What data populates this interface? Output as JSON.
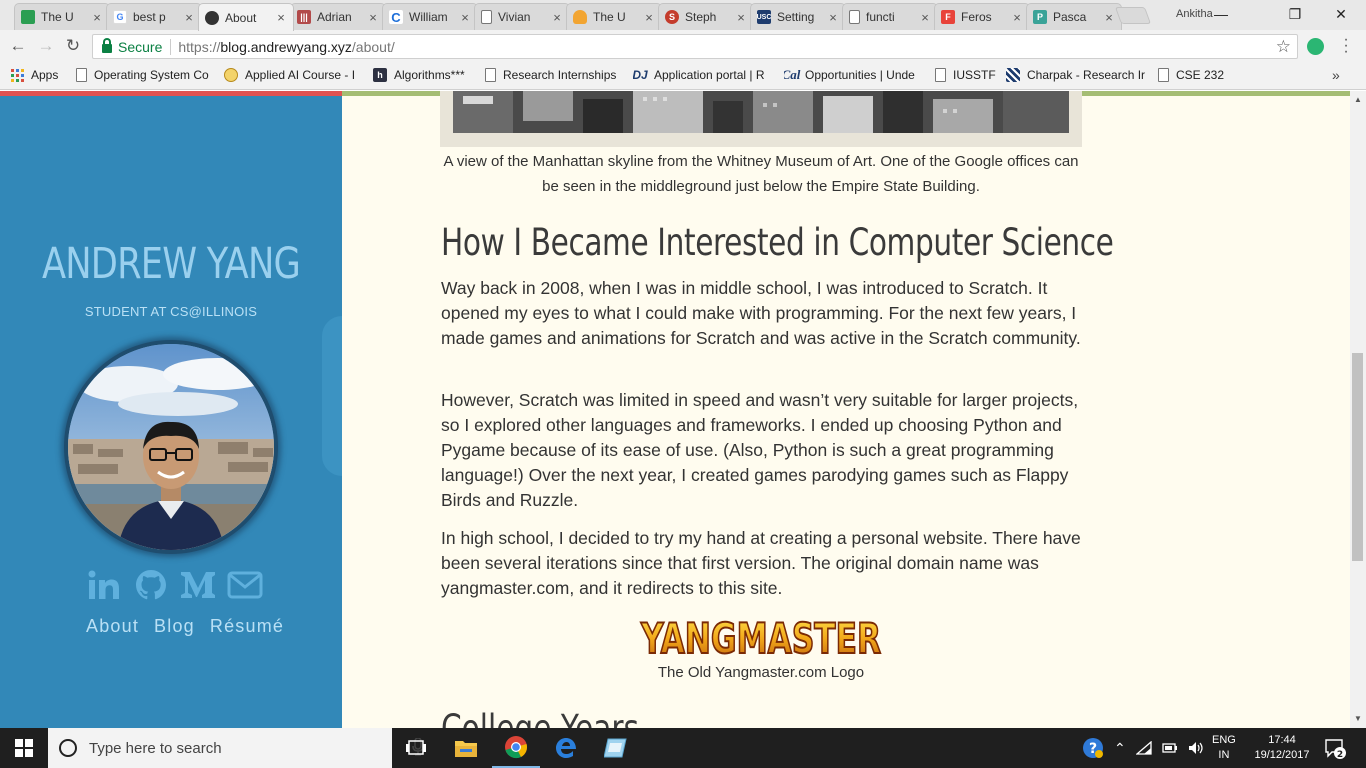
{
  "browser": {
    "tabs": [
      {
        "title": "The U",
        "icon": "classroom-icon",
        "color": "#2b9e52"
      },
      {
        "title": "best p",
        "icon": "google-icon",
        "color": "#4285f4"
      },
      {
        "title": "About",
        "icon": "site-icon",
        "color": "#333333",
        "active": true
      },
      {
        "title": "Adrian",
        "icon": "bars-icon",
        "color": "#b24a4a"
      },
      {
        "title": "William",
        "icon": "c-icon",
        "color": "#1e6fd9"
      },
      {
        "title": "Vivian",
        "icon": "page-icon",
        "color": "#777777"
      },
      {
        "title": "The U",
        "icon": "cloud-icon",
        "color": "#f2a532"
      },
      {
        "title": "Steph",
        "icon": "s-icon",
        "color": "#c43c2c"
      },
      {
        "title": "Setting",
        "icon": "usc-icon",
        "color": "#1e3c6e"
      },
      {
        "title": "functi",
        "icon": "page-icon",
        "color": "#777777"
      },
      {
        "title": "Feros",
        "icon": "f-icon",
        "color": "#e8433a"
      },
      {
        "title": "Pasca",
        "icon": "p-icon",
        "color": "#3aa398"
      }
    ],
    "profile_name": "Ankitha",
    "window_controls": {
      "minimize": "—",
      "maximize": "❐",
      "close": "✕"
    },
    "secure_label": "Secure",
    "url_prefix": "https://",
    "url_host": "blog.andrewyang.xyz",
    "url_path": "/about/",
    "bookmarks": [
      {
        "label": "Apps",
        "icon": "apps-grid-icon"
      },
      {
        "label": "Operating System Co",
        "icon": "page-icon"
      },
      {
        "label": "Applied AI Course - I",
        "icon": "ai-course-icon"
      },
      {
        "label": "Algorithms***",
        "icon": "h-icon"
      },
      {
        "label": "Research Internships",
        "icon": "page-icon"
      },
      {
        "label": "Application portal | R",
        "icon": "dj-icon"
      },
      {
        "label": "Opportunities | Unde",
        "icon": "cal-icon"
      },
      {
        "label": "IUSSTF",
        "icon": "page-icon"
      },
      {
        "label": "Charpak - Research Ir",
        "icon": "charpak-icon"
      },
      {
        "label": "CSE 232",
        "icon": "page-icon"
      }
    ],
    "bookmarks_overflow": "»"
  },
  "sidebar": {
    "name": "ANDREW YANG",
    "subtitle": "STUDENT AT CS@ILLINOIS",
    "social": [
      "linkedin-icon",
      "github-icon",
      "medium-icon",
      "mail-icon"
    ],
    "nav": [
      "About",
      "Blog",
      "Résumé"
    ]
  },
  "article": {
    "image_caption": "A view of the Manhattan skyline from the Whitney Museum of Art. One of the Google offices can be seen in the middleground just below the Empire State Building.",
    "heading": "How I Became Interested in Computer Science",
    "paragraphs": [
      "Way back in 2008, when I was in middle school, I was introduced to Scratch. It opened my eyes to what I could make with programming. For the next few years, I made games and animations for Scratch and was active in the Scratch community.",
      "However, Scratch was limited in speed and wasn’t very suitable for larger projects, so I explored other languages and frameworks. I ended up choosing Python and Pygame because of its ease of use. (Also, Python is such a great programming language!) Over the next year, I created games parodying games such as Flappy Birds and Ruzzle.",
      "In high school, I decided to try my hand at creating a personal website. There have been several iterations since that first version. The original domain name was yangmaster.com, and it redirects to this site."
    ],
    "logo_text": "YANGMASTER",
    "logo_caption": "The Old Yangmaster.com Logo",
    "next_heading": "College Years"
  },
  "taskbar": {
    "search_placeholder": "Type here to search",
    "apps": [
      "task-view-icon",
      "file-explorer-icon",
      "chrome-icon",
      "edge-icon",
      "app-icon"
    ],
    "language_line1": "ENG",
    "language_line2": "IN",
    "time": "17:44",
    "date": "19/12/2017",
    "notification_count": "2"
  },
  "colors": {
    "sidebar_bg": "#3288b8",
    "page_bg": "#fffcef",
    "accent_red": "#e05252",
    "accent_green": "#a5bd74",
    "secure_green": "#0b8043"
  }
}
